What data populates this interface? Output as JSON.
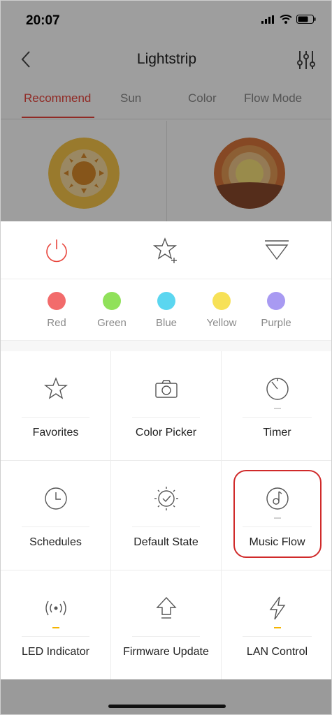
{
  "status_bar": {
    "time": "20:07"
  },
  "nav": {
    "title": "Lightstrip"
  },
  "tabs": [
    {
      "label": "Recommend",
      "active": true
    },
    {
      "label": "Sun",
      "active": false
    },
    {
      "label": "Color",
      "active": false
    },
    {
      "label": "Flow Mode",
      "active": false
    }
  ],
  "actions": [
    {
      "name": "power-icon",
      "color": "#e8453c"
    },
    {
      "name": "star-plus-icon",
      "color": "#555555"
    },
    {
      "name": "dropdown-triangle-icon",
      "color": "#555555"
    }
  ],
  "colors": [
    {
      "label": "Red",
      "hex": "#f26b6b"
    },
    {
      "label": "Green",
      "hex": "#90e15a"
    },
    {
      "label": "Blue",
      "hex": "#5bd6f0"
    },
    {
      "label": "Yellow",
      "hex": "#f7e157"
    },
    {
      "label": "Purple",
      "hex": "#a89af2"
    }
  ],
  "grid": [
    {
      "label": "Favorites",
      "icon": "star-icon"
    },
    {
      "label": "Color Picker",
      "icon": "camera-icon"
    },
    {
      "label": "Timer",
      "icon": "timer-icon"
    },
    {
      "label": "Schedules",
      "icon": "clock-icon"
    },
    {
      "label": "Default State",
      "icon": "default-state-icon"
    },
    {
      "label": "Music Flow",
      "icon": "music-flow-icon"
    },
    {
      "label": "LED Indicator",
      "icon": "led-indicator-icon"
    },
    {
      "label": "Firmware Update",
      "icon": "firmware-update-icon"
    },
    {
      "label": "LAN Control",
      "icon": "lightning-icon"
    }
  ],
  "theme": {
    "accent": "#e8453c",
    "indicator_on": "#f5b400",
    "indicator_off": "#cfcfcf"
  }
}
